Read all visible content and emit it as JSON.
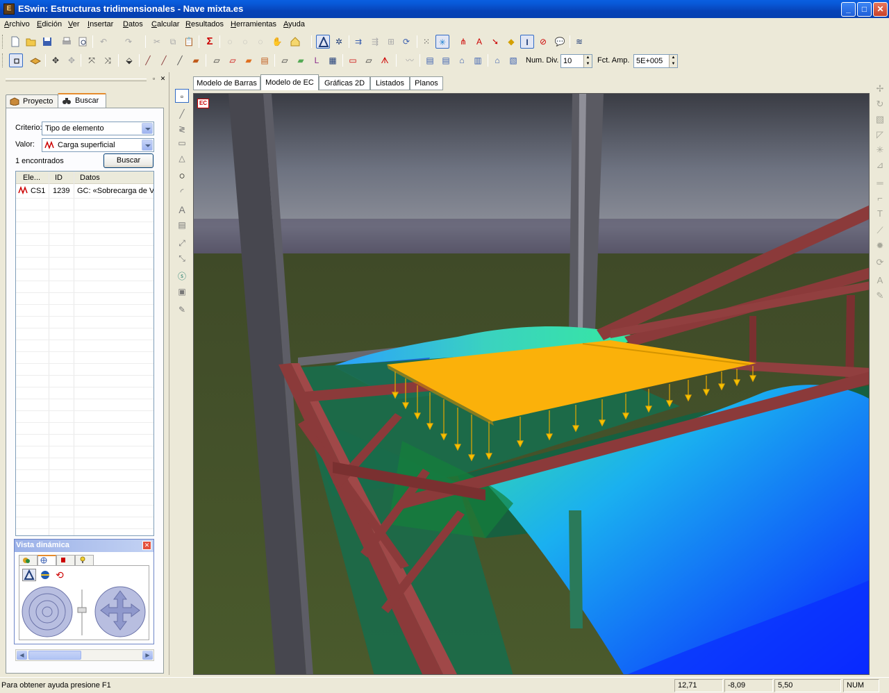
{
  "window": {
    "title": "ESwin: Estructuras tridimensionales - Nave mixta.es",
    "controls": [
      "_",
      "□",
      "✕"
    ]
  },
  "menu": [
    "Archivo",
    "Edición",
    "Ver",
    "Insertar",
    "Datos",
    "Calcular",
    "Resultados",
    "Herramientas",
    "Ayuda"
  ],
  "toolbar2": {
    "num_div_label": "Num. Div.",
    "num_div_value": "10",
    "fct_amp_label": "Fct. Amp.",
    "fct_amp_value": "5E+005"
  },
  "left_panel": {
    "tabs": [
      "Proyecto",
      "Buscar"
    ],
    "active_tab": "Buscar",
    "criterio_label": "Criterio:",
    "criterio_value": "Tipo de elemento",
    "valor_label": "Valor:",
    "valor_value": "Carga superficial",
    "found_text": "1 encontrados",
    "buscar_button": "Buscar",
    "columns": [
      "Ele...",
      "ID",
      "Datos"
    ],
    "rows": [
      {
        "element": "CS1",
        "id": "1239",
        "datos": "GC: «Sobrecarga de Vi"
      }
    ]
  },
  "vista_dinamica": {
    "title": "Vista dinámica",
    "close": "✕"
  },
  "doc_tabs": [
    "Modelo de Barras",
    "Modelo de EC",
    "Gráficas 2D",
    "Listados",
    "Planos"
  ],
  "active_doc_tab": "Modelo de EC",
  "viewport": {
    "badge": "EC"
  },
  "status": {
    "help": "Para obtener ayuda presione F1",
    "x": "12,71",
    "y": "-8,09",
    "z": "5,50",
    "num": "NUM"
  },
  "colors": {
    "titlebar": "#0743b8",
    "frame": "#8b3a3a",
    "load_plane": "#fbb10a",
    "sheet_dark": "#1a6b4a",
    "shell_blue": "#1e8cff",
    "grass": "#4a5a2c"
  }
}
